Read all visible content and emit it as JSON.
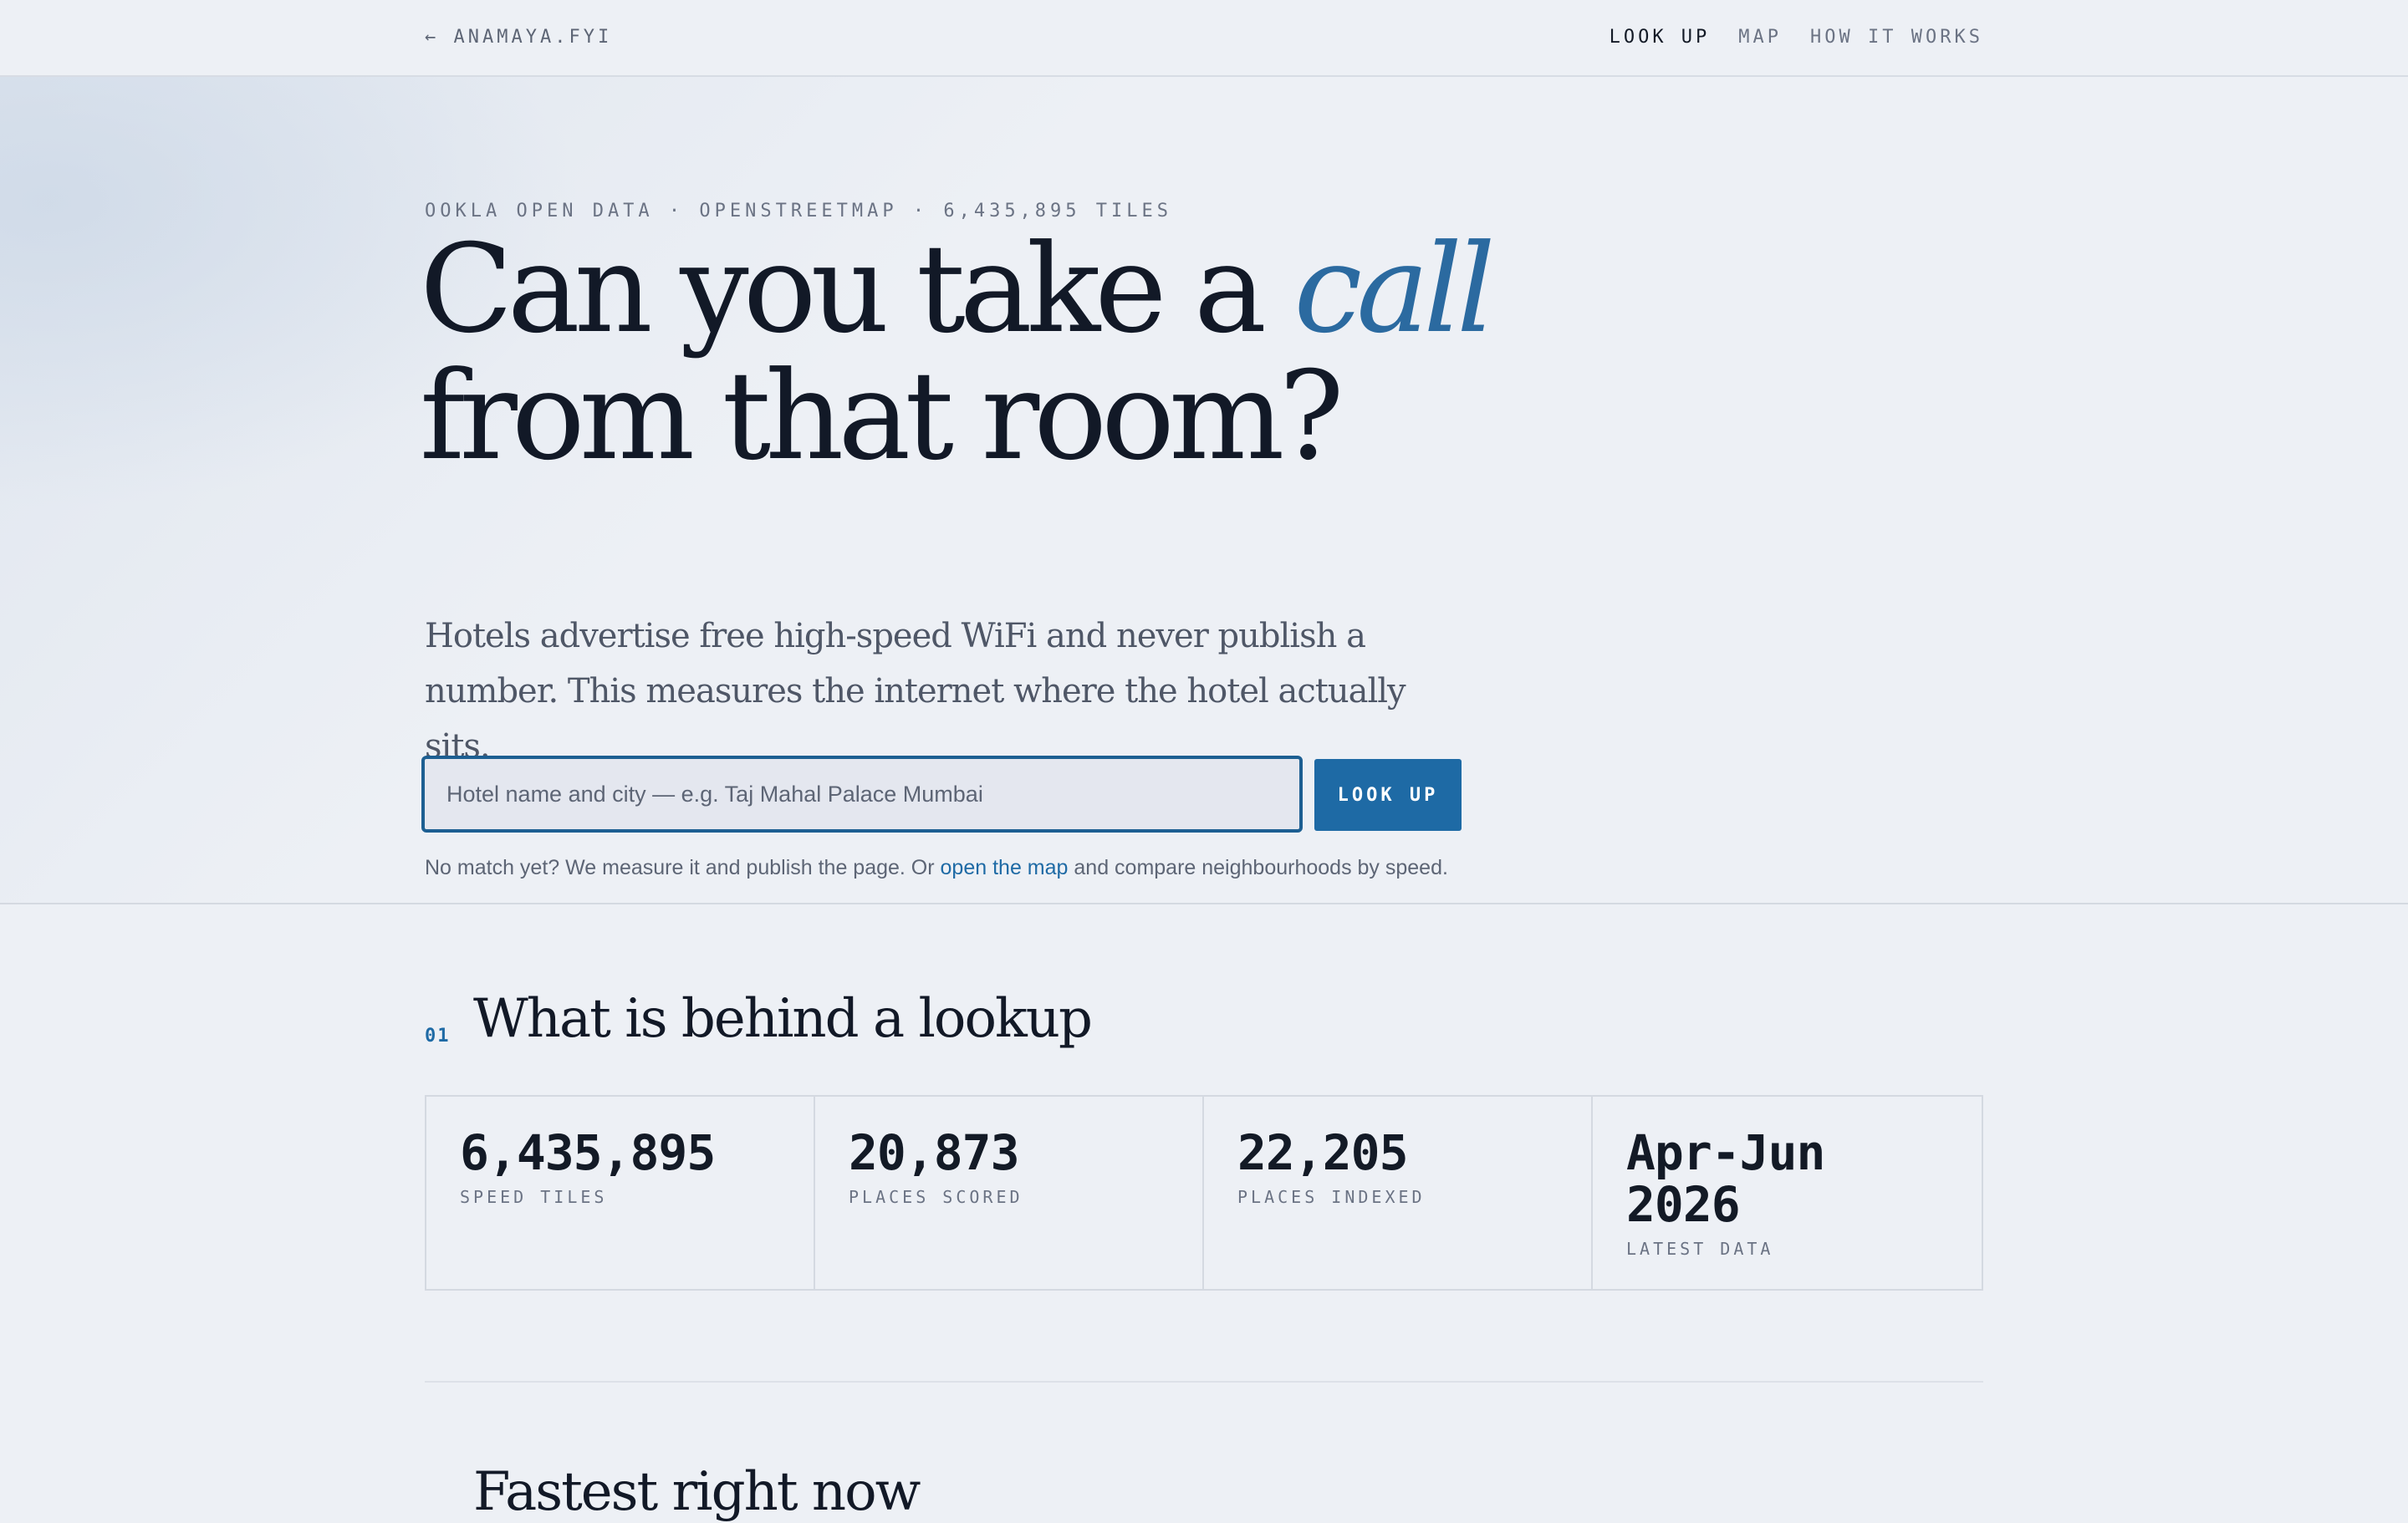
{
  "header": {
    "brand": "← ANAMAYA.FYI",
    "nav": [
      "LOOK UP",
      "MAP",
      "HOW IT WORKS"
    ]
  },
  "hero": {
    "eyebrow": "OOKLA OPEN DATA · OPENSTREETMAP · 6,435,895 TILES",
    "headline_line1_start": "Can you take a ",
    "headline_line1_accent": "call",
    "headline_line2": "from that room?",
    "subhead": "Hotels advertise free high-speed WiFi and never publish a number. This measures the internet where the hotel actually sits.",
    "search_placeholder": "Hotel name and city — e.g. Taj Mahal Palace Mumbai",
    "search_value": "",
    "lookup_button": "LOOK UP",
    "note_before": "No match yet? We measure it and publish the page. Or ",
    "note_link": "open the map",
    "note_after": " and compare neighbourhoods by speed."
  },
  "section1": {
    "number": "01",
    "title": "What is behind a lookup",
    "stats": [
      {
        "value": "6,435,895",
        "label": "SPEED TILES"
      },
      {
        "value": "20,873",
        "label": "PLACES SCORED"
      },
      {
        "value": "22,205",
        "label": "PLACES INDEXED"
      },
      {
        "value": "Apr-Jun 2026",
        "label": "LATEST DATA"
      }
    ]
  },
  "section2": {
    "title": "Fastest right now"
  },
  "colors": {
    "accent": "#1e6aa5",
    "background": "#edf0f5",
    "text": "#131a26"
  }
}
